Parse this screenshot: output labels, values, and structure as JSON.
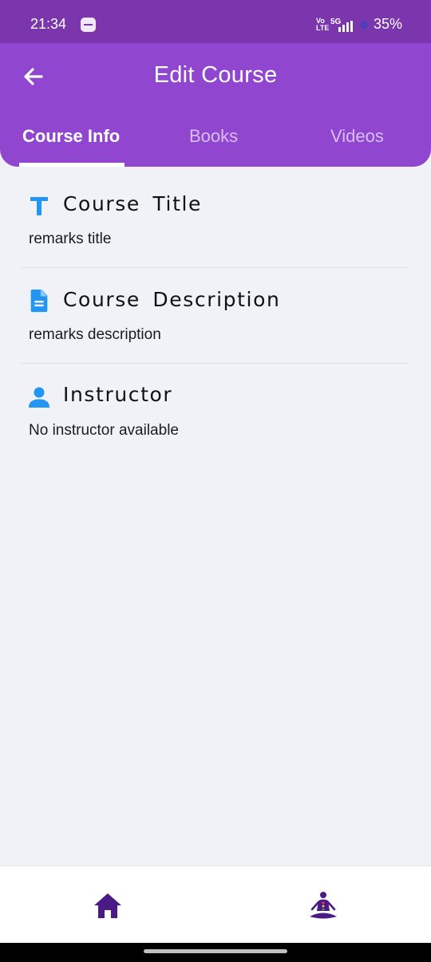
{
  "status_bar": {
    "time": "21:34",
    "network": "Vo\nLTE",
    "signal": "5G",
    "battery": "35%"
  },
  "header": {
    "title": "Edit Course",
    "back_icon": "arrow-left-icon",
    "tabs": [
      {
        "label": "Course Info",
        "active": true
      },
      {
        "label": "Books",
        "active": false
      },
      {
        "label": "Videos",
        "active": false
      }
    ],
    "color": "#9046cf"
  },
  "sections": [
    {
      "icon": "title-icon",
      "title": "Course Title",
      "value": "remarks title"
    },
    {
      "icon": "document-icon",
      "title": "Course Description",
      "value": "remarks description"
    },
    {
      "icon": "person-icon",
      "title": "Instructor",
      "value": "No instructor available"
    }
  ],
  "icon_color": "#2196f3",
  "bottom_nav": {
    "items": [
      {
        "icon": "home-icon"
      },
      {
        "icon": "meditation-icon"
      }
    ],
    "color": "#4a1a86"
  }
}
